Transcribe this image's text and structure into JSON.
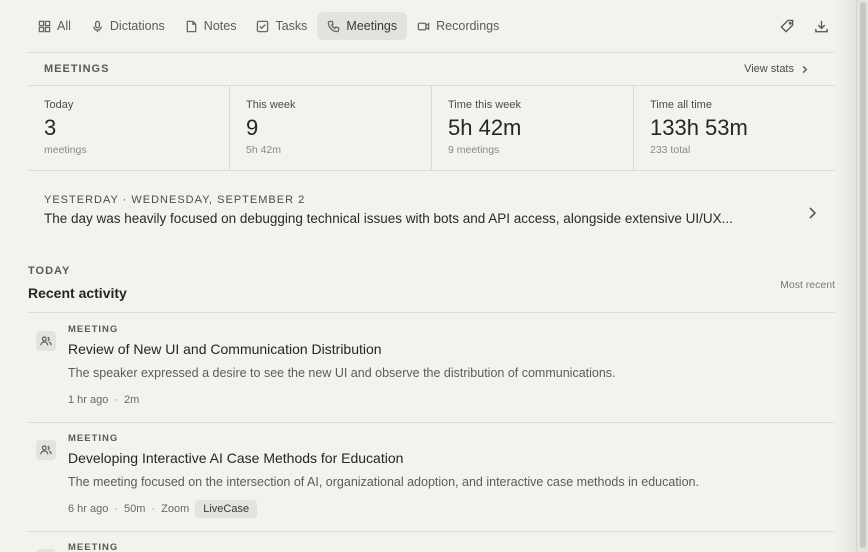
{
  "tabs": [
    {
      "label": "All",
      "icon": "grid-icon",
      "active": false
    },
    {
      "label": "Dictations",
      "icon": "mic-icon",
      "active": false
    },
    {
      "label": "Notes",
      "icon": "note-icon",
      "active": false
    },
    {
      "label": "Tasks",
      "icon": "checkbox-icon",
      "active": false
    },
    {
      "label": "Meetings",
      "icon": "phone-icon",
      "active": true
    },
    {
      "label": "Recordings",
      "icon": "video-icon",
      "active": false
    }
  ],
  "stats": {
    "section_label": "MEETINGS",
    "view_stats_label": "View stats",
    "cells": [
      {
        "label": "Today",
        "value": "3",
        "sub": "meetings"
      },
      {
        "label": "This week",
        "value": "9",
        "sub": "5h 42m"
      },
      {
        "label": "Time this week",
        "value": "5h 42m",
        "sub": "9 meetings"
      },
      {
        "label": "Time all time",
        "value": "133h 53m",
        "sub": "233 total"
      }
    ]
  },
  "yesterday": {
    "label": "YESTERDAY · WEDNESDAY, SEPTEMBER 2",
    "summary": "The day was heavily focused on debugging technical issues with bots and API access, alongside extensive UI/UX..."
  },
  "today": {
    "label": "TODAY",
    "title": "Recent activity",
    "sort_label": "Most recent"
  },
  "activity": [
    {
      "type": "MEETING",
      "title": "Review of New UI and Communication Distribution",
      "description": "The speaker expressed a desire to see the new UI and observe the distribution of communications.",
      "time": "1 hr ago",
      "duration": "2m"
    },
    {
      "type": "MEETING",
      "title": "Developing Interactive AI Case Methods for Education",
      "description": "The meeting focused on the intersection of AI, organizational adoption, and interactive case methods in education.",
      "time": "6 hr ago",
      "duration": "50m",
      "source": "Zoom",
      "tag": "LiveCase"
    },
    {
      "type": "MEETING"
    }
  ]
}
